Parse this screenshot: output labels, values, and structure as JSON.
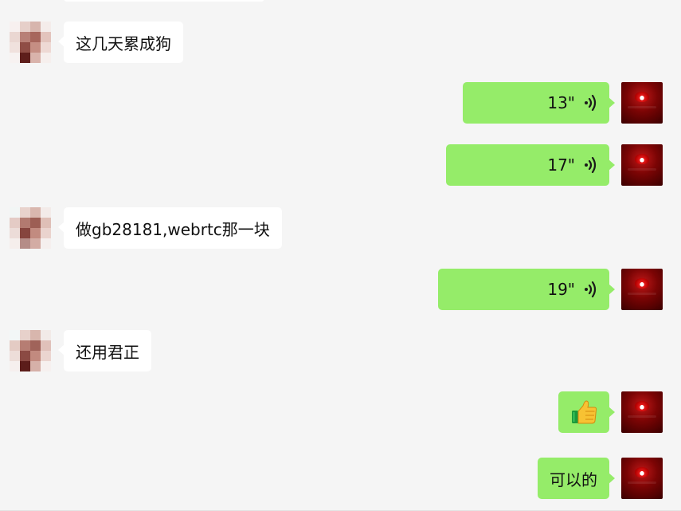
{
  "messages": [
    {
      "side": "left",
      "type": "text",
      "text": "这几天累成狗"
    },
    {
      "side": "right",
      "type": "voice",
      "duration": "13\""
    },
    {
      "side": "right",
      "type": "voice",
      "duration": "17\""
    },
    {
      "side": "left",
      "type": "text",
      "text": "做gb28181,webrtc那一块"
    },
    {
      "side": "right",
      "type": "voice",
      "duration": "19\""
    },
    {
      "side": "left",
      "type": "text",
      "text": "还用君正"
    },
    {
      "side": "right",
      "type": "emoji",
      "emoji": "thumbs-up-icon"
    },
    {
      "side": "right",
      "type": "text",
      "text": "可以的"
    }
  ],
  "colors": {
    "background": "#f5f5f5",
    "received_bubble": "#ffffff",
    "sent_bubble": "#95ec69",
    "voice_icon": "#1a1a1a"
  }
}
